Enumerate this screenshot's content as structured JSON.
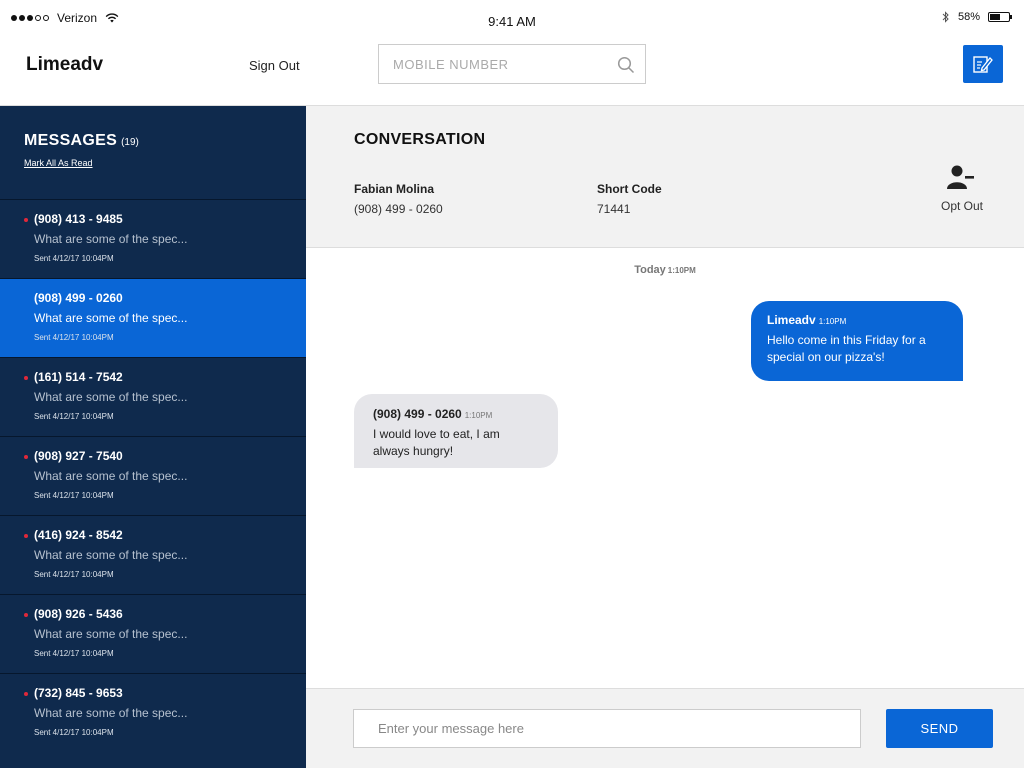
{
  "status_bar": {
    "carrier": "Verizon",
    "time": "9:41 AM",
    "battery_percent": "58%",
    "battery_level": 0.58
  },
  "header": {
    "brand": "Limeadv",
    "sign_out": "Sign Out",
    "search_placeholder": "MOBILE NUMBER",
    "compose_icon": "compose-icon"
  },
  "sidebar": {
    "title": "MESSAGES",
    "count": "(19)",
    "mark_all_read": "Mark All As Read",
    "conversations": [
      {
        "phone": "(908) 413 - 9485",
        "preview": "What are some of the spec...",
        "time": "Sent 4/12/17 10:04PM",
        "unread": true,
        "active": false
      },
      {
        "phone": "(908) 499 - 0260",
        "preview": "What are some of the spec...",
        "time": "Sent 4/12/17 10:04PM",
        "unread": false,
        "active": true
      },
      {
        "phone": "(161) 514 - 7542",
        "preview": "What are some of the spec...",
        "time": "Sent 4/12/17 10:04PM",
        "unread": true,
        "active": false
      },
      {
        "phone": "(908) 927 - 7540",
        "preview": "What are some of the spec...",
        "time": "Sent 4/12/17 10:04PM",
        "unread": true,
        "active": false
      },
      {
        "phone": "(416) 924 - 8542",
        "preview": "What are some of the spec...",
        "time": "Sent 4/12/17 10:04PM",
        "unread": true,
        "active": false
      },
      {
        "phone": "(908) 926 - 5436",
        "preview": "What are some of the spec...",
        "time": "Sent 4/12/17 10:04PM",
        "unread": true,
        "active": false
      },
      {
        "phone": "(732) 845 - 9653",
        "preview": "What are some of the spec...",
        "time": "Sent 4/12/17 10:04PM",
        "unread": true,
        "active": false
      }
    ]
  },
  "conversation": {
    "title": "CONVERSATION",
    "contact_name": "Fabian Molina",
    "contact_phone": "(908) 499 - 0260",
    "short_code_label": "Short Code",
    "short_code_value": "71441",
    "opt_out_label": "Opt Out",
    "day_label": "Today",
    "day_time": "1:10PM",
    "messages": [
      {
        "sender": "Limeadv",
        "time": "1:10PM",
        "text": "Hello come in this Friday for a special on our pizza's!",
        "direction": "out"
      },
      {
        "sender": "(908) 499 - 0260",
        "time": "1:10PM",
        "text": "I would love to eat, I am always hungry!",
        "direction": "in"
      }
    ]
  },
  "composer": {
    "placeholder": "Enter your message here",
    "send_label": "SEND"
  },
  "colors": {
    "primary": "#0a66d6",
    "sidebar_bg": "#0f2a4d",
    "unread_dot": "#e0283a"
  }
}
